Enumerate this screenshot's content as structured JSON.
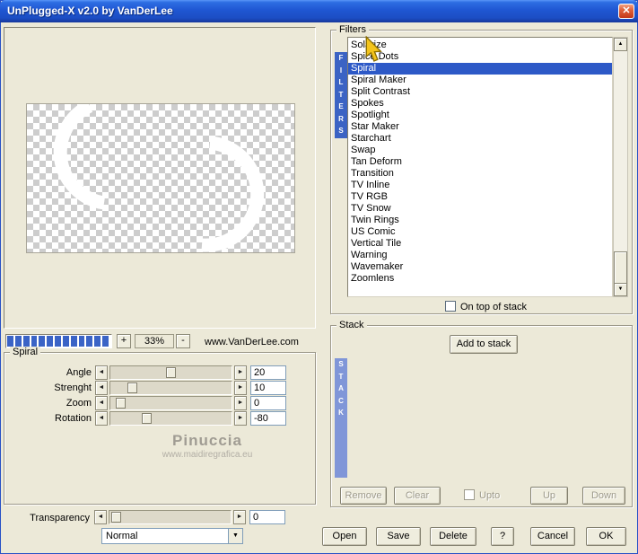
{
  "window": {
    "title": "UnPlugged-X v2.0 by VanDerLee",
    "close_glyph": "✕"
  },
  "preview": {
    "zoom_in_label": "+",
    "zoom_out_label": "-",
    "zoom_value": "33%",
    "website": "www.VanDerLee.com",
    "progress_segments": 13,
    "progress_color": "#3A63C6"
  },
  "spiral": {
    "title": "Spiral",
    "sliders": [
      {
        "label": "Angle",
        "value": "20",
        "pct": 50
      },
      {
        "label": "Strenght",
        "value": "10",
        "pct": 15
      },
      {
        "label": "Zoom",
        "value": "0",
        "pct": 5
      },
      {
        "label": "Rotation",
        "value": "-80",
        "pct": 28
      }
    ],
    "watermark": "Pinuccia",
    "watermark_url": "www.maidiregrafica.eu"
  },
  "transparency": {
    "label": "Transparency",
    "value": "0",
    "pct": 2,
    "blend_mode": "Normal"
  },
  "filters": {
    "title": "Filters",
    "tab": "FILTERS",
    "items": [
      "Solarize",
      "Spice Dots",
      "Spiral",
      "Spiral Maker",
      "Split Contrast",
      "Spokes",
      "Spotlight",
      "Star Maker",
      "Starchart",
      "Swap",
      "Tan Deform",
      "Transition",
      "TV Inline",
      "TV RGB",
      "TV Snow",
      "Twin Rings",
      "US Comic",
      "Vertical Tile",
      "Warning",
      "Wavemaker",
      "Zoomlens"
    ],
    "selected_index": 2,
    "selected_item": "Spiral",
    "selection_color": "#2D59C7",
    "checkbox_label": "On top of stack"
  },
  "stack": {
    "title": "Stack",
    "tab": "STACK",
    "add_button": "Add to stack",
    "remove_button": "Remove",
    "clear_button": "Clear",
    "upto_label": "Upto",
    "up_button": "Up",
    "down_button": "Down"
  },
  "actions": {
    "open": "Open",
    "save": "Save",
    "delete": "Delete",
    "help": "?",
    "cancel": "Cancel",
    "ok": "OK"
  }
}
